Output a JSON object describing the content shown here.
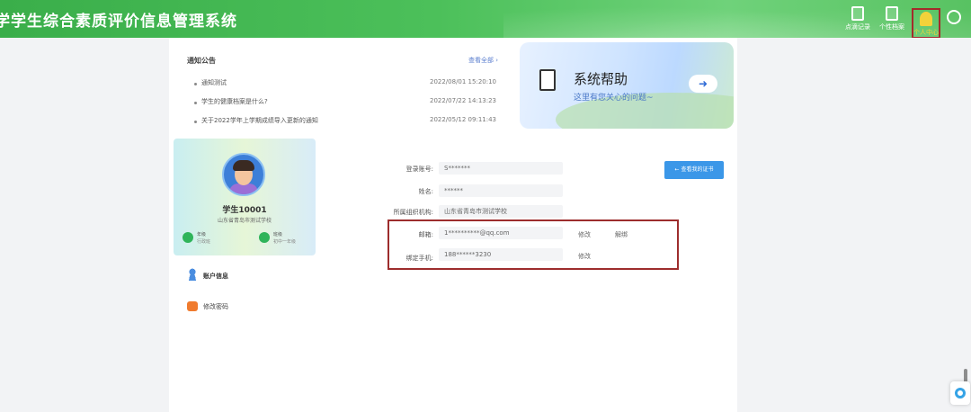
{
  "header": {
    "title": "学学生综合素质评价信息管理系统",
    "nav": [
      {
        "label": "点滴记录",
        "icon": "record-icon"
      },
      {
        "label": "个性档案",
        "icon": "archive-icon"
      },
      {
        "label": "个人中心",
        "icon": "person-icon"
      }
    ]
  },
  "notices": {
    "title": "通知公告",
    "more": "查看全部 ›",
    "items": [
      {
        "title": "通知测试",
        "date": "2022/08/01 15:20:10"
      },
      {
        "title": "学生的健康档案是什么?",
        "date": "2022/07/22 14:13:23"
      },
      {
        "title": "关于2022学年上学期成绩导入更新的通知",
        "date": "2022/05/12 09:11:43"
      }
    ]
  },
  "help": {
    "title": "系统帮助",
    "subtitle": "这里有您关心的问题~",
    "arrow": "➜"
  },
  "profile": {
    "name": "学生10001",
    "school": "山东省青岛市测试学校",
    "grade_label": "年级",
    "grade_value": "行政班",
    "class_label": "班级",
    "class_value": "初中一年级"
  },
  "menu": [
    {
      "label": "账户信息"
    },
    {
      "label": "修改密码"
    }
  ],
  "form": {
    "account_label": "登录账号:",
    "account_value": "S*******",
    "name_label": "姓名:",
    "name_value": "******",
    "org_label": "所属组织机构:",
    "org_value": "山东省青岛市测试学校",
    "email_label": "邮箱:",
    "email_value": "1**********@qq.com",
    "email_action1": "修改",
    "email_action2": "解绑",
    "phone_label": "绑定手机:",
    "phone_value": "188******3230",
    "phone_action": "修改",
    "cert_button": "← 查看我的证书"
  }
}
